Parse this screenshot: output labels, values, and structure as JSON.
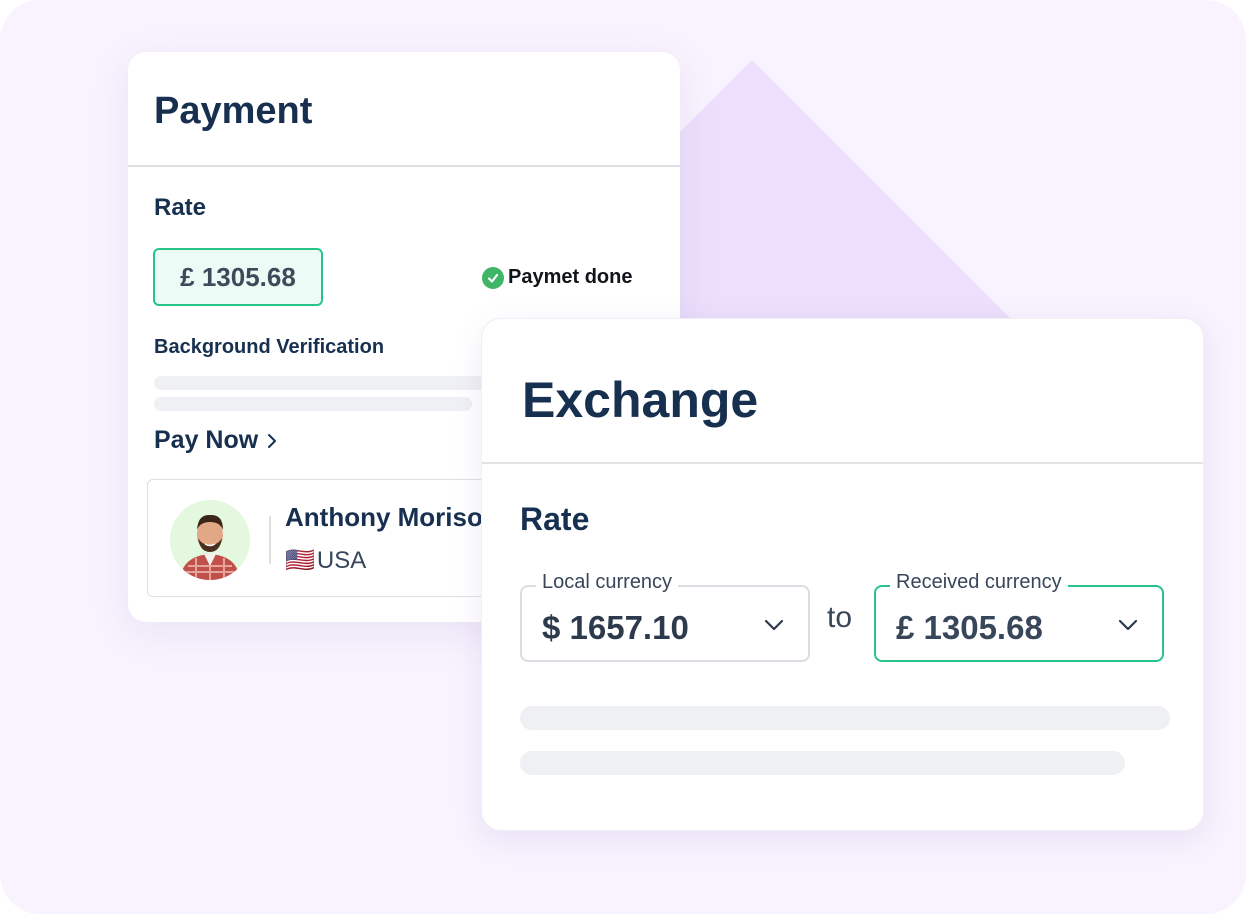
{
  "payment": {
    "title": "Payment",
    "rate_label": "Rate",
    "rate_value": "£ 1305.68",
    "status_text": "Paymet done",
    "verification_label": "Background Verification",
    "pay_now_label": "Pay Now",
    "user": {
      "name": "Anthony Morison",
      "country_flag": "🇺🇸",
      "country": "USA"
    }
  },
  "exchange": {
    "title": "Exchange",
    "rate_label": "Rate",
    "local_currency": {
      "label": "Local currency",
      "value": "$ 1657.10"
    },
    "connector": "to",
    "received_currency": {
      "label": "Received currency",
      "value": "£ 1305.68"
    }
  },
  "colors": {
    "accent_green": "#27c489",
    "success_check": "#3eb568",
    "heading_navy": "#17304f",
    "background_lavender": "#f8f3fe",
    "decorative_purple": "#e6d9fb"
  },
  "icons": {
    "status": "check-circle-icon",
    "pay_now": "chevron-right-icon",
    "dropdown": "chevron-down-icon"
  }
}
